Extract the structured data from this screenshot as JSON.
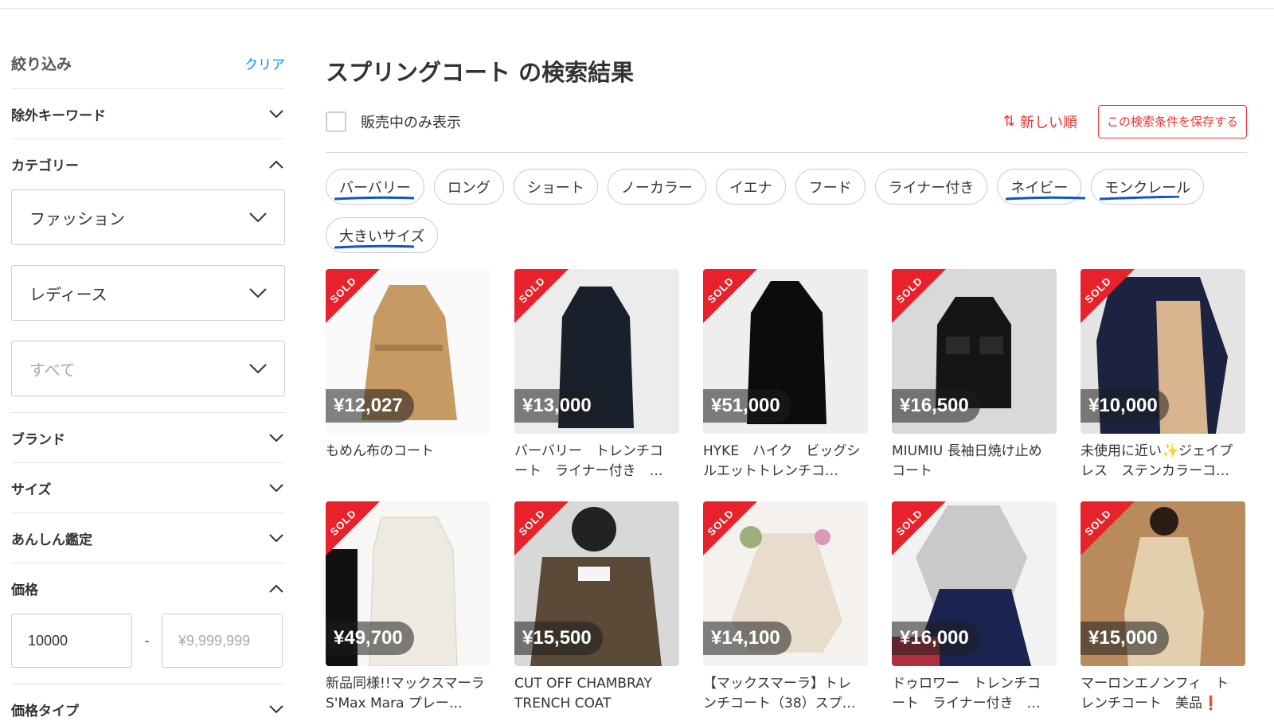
{
  "sidebar": {
    "title": "絞り込み",
    "clear": "クリア",
    "sections": {
      "exclude_keyword": "除外キーワード",
      "category": "カテゴリー",
      "brand": "ブランド",
      "size": "サイズ",
      "authentication": "あんしん鑑定",
      "price": "価格",
      "price_type": "価格タイプ"
    },
    "category_selects": [
      "ファッション",
      "レディース",
      "すべて"
    ],
    "price": {
      "min_value": "10000",
      "max_placeholder": "¥9,999,999",
      "dash": "-"
    }
  },
  "main": {
    "title": "スプリングコート の検索結果",
    "onsale_label": "販売中のみ表示",
    "sort_label": "新しい順",
    "sort_icon": "⇅",
    "save_button": "この検索条件を保存する",
    "chips": [
      "バーバリー",
      "ロング",
      "ショート",
      "ノーカラー",
      "イエナ",
      "フード",
      "ライナー付き",
      "ネイビー",
      "モンクレール",
      "大きいサイズ"
    ],
    "sold_label": "SOLD",
    "items": [
      {
        "price": "¥12,027",
        "name": "もめん布のコート"
      },
      {
        "price": "¥13,000",
        "name": "バーバリー　トレンチコート　ライナー付き　…"
      },
      {
        "price": "¥51,000",
        "name": "HYKE　ハイク　ビッグシルエットトレンチコ…"
      },
      {
        "price": "¥16,500",
        "name": "MIUMIU 長袖日焼け止めコート"
      },
      {
        "price": "¥10,000",
        "name": "未使用に近い✨ジェイプレス　ステンカラーコ…"
      },
      {
        "price": "¥49,700",
        "name": "新品同様!!マックスマーラ S'Max Mara プレー…"
      },
      {
        "price": "¥15,500",
        "name": "CUT OFF CHAMBRAY TRENCH COAT"
      },
      {
        "price": "¥14,100",
        "name": "【マックスマーラ】トレンチコート（38）スプ…"
      },
      {
        "price": "¥16,000",
        "name": "ドゥロワー　トレンチコート　ライナー付き　…"
      },
      {
        "price": "¥15,000",
        "name": "マーロンエノンフィ　トレンチコート　美品❗"
      }
    ]
  },
  "colors": {
    "accent_red": "#e8222a",
    "link_blue": "#0095ee",
    "annotation_blue": "#1155cc"
  }
}
